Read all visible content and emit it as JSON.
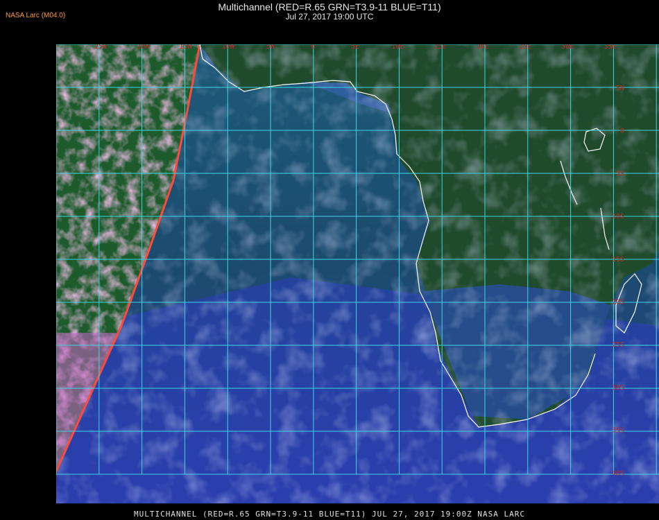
{
  "header": {
    "credit": "NASA Larc (M04.0)",
    "title": "Multichannel (RED=R.65 GRN=T3.9-11 BLUE=T11)",
    "subtitle": "Jul 27, 2017 19:00 UTC"
  },
  "footer": {
    "caption": "MULTICHANNEL (RED=R.65 GRN=T3.9-11 BLUE=T11) JUL 27, 2017 19:00Z   NASA LARC"
  },
  "grid": {
    "lon_labels": [
      "25W",
      "20W",
      "15W",
      "10W",
      "5W",
      "0",
      "5E",
      "10E",
      "15E",
      "20E",
      "25E",
      "30E",
      "35E"
    ],
    "lat_labels": [
      "5N",
      "0",
      "5S",
      "10S",
      "15S",
      "20S",
      "25S",
      "30S",
      "35S",
      "40S"
    ]
  },
  "colors": {
    "grid": "#3fd6e6",
    "coast": "#ffffff",
    "labels": "#c22a2a",
    "credit": "#ff9a3a"
  }
}
